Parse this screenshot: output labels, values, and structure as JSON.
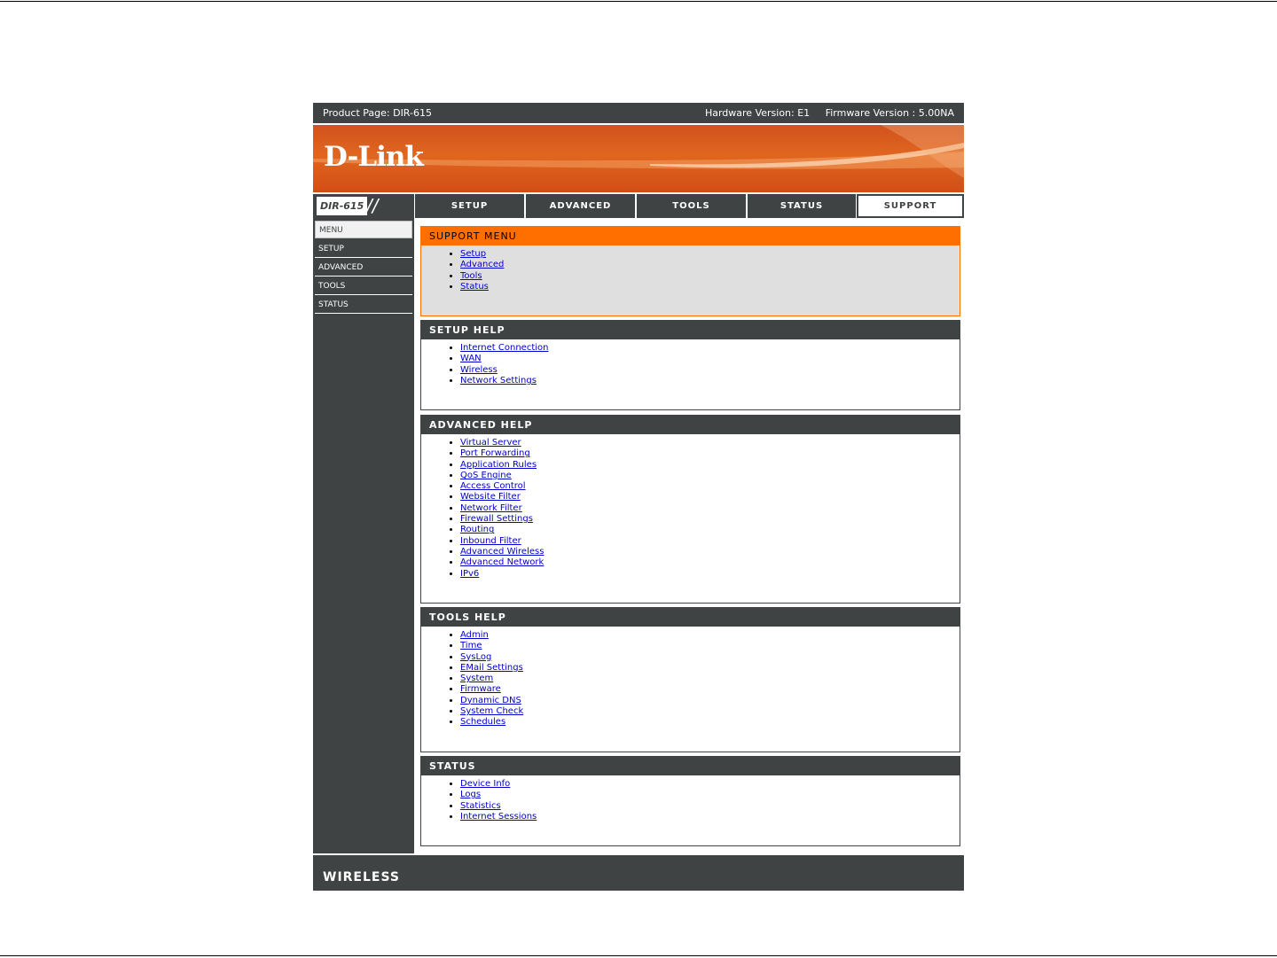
{
  "header": {
    "product": "Product Page: DIR-615",
    "hardware": "Hardware Version: E1",
    "firmware": "Firmware Version : 5.00NA"
  },
  "banner": {
    "logo": "D-Link"
  },
  "nav": {
    "model": "DIR-615",
    "slashes": "//",
    "tabs": [
      "SETUP",
      "ADVANCED",
      "TOOLS",
      "STATUS",
      "SUPPORT"
    ],
    "active_tab": "SUPPORT"
  },
  "sidebar": {
    "items": [
      "MENU",
      "SETUP",
      "ADVANCED",
      "TOOLS",
      "STATUS"
    ]
  },
  "panels": {
    "support_menu": {
      "title": "SUPPORT MENU",
      "links": [
        "Setup",
        "Advanced",
        "Tools",
        "Status"
      ]
    },
    "setup_help": {
      "title": "SETUP HELP",
      "links": [
        "Internet Connection",
        "WAN",
        "Wireless",
        "Network Settings"
      ]
    },
    "advanced_help": {
      "title": "ADVANCED HELP",
      "links": [
        "Virtual Server",
        "Port Forwarding",
        "Application Rules",
        "QoS Engine",
        "Access Control",
        "Website Filter",
        "Network Filter",
        "Firewall Settings",
        "Routing",
        "Inbound Filter",
        "Advanced Wireless",
        "Advanced Network",
        "IPv6"
      ]
    },
    "tools_help": {
      "title": "TOOLS HELP",
      "links": [
        "Admin",
        "Time",
        "SysLog",
        "EMail Settings",
        "System",
        "Firmware",
        "Dynamic DNS",
        "System Check",
        "Schedules"
      ]
    },
    "status": {
      "title": "STATUS",
      "links": [
        "Device Info",
        "Logs",
        "Statistics",
        "Internet Sessions"
      ]
    }
  },
  "footer": {
    "brand": "WIRELESS"
  },
  "colors": {
    "dark": "#404343",
    "accent": "#ff6f00",
    "banner": "#e0661f",
    "link": "#0000cc"
  }
}
